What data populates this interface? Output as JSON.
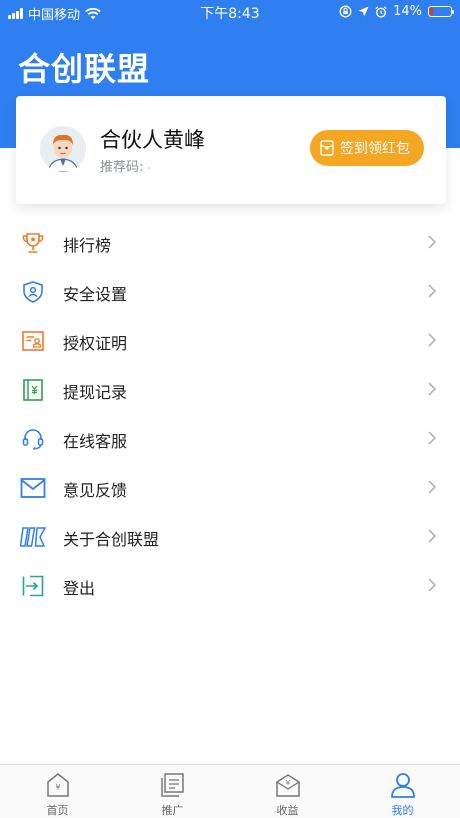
{
  "status_bar": {
    "carrier": "中国移动",
    "time": "下午8:43",
    "battery_pct": "14%",
    "battery_level": 0.14,
    "battery_color": "#e8342e"
  },
  "header": {
    "title": "合创联盟",
    "bg_color": "#2f7ff0"
  },
  "profile": {
    "name": "合伙人黄峰",
    "referral_label": "推荐码:",
    "referral_value": ".",
    "signin_button": "签到领红包",
    "signin_color": "#f5a623"
  },
  "menu": {
    "items": [
      {
        "label": "排行榜",
        "icon": "trophy-icon",
        "color": "#f07a2c"
      },
      {
        "label": "安全设置",
        "icon": "shield-user-icon",
        "color": "#2f7ff0"
      },
      {
        "label": "授权证明",
        "icon": "certificate-icon",
        "color": "#f07a2c"
      },
      {
        "label": "提现记录",
        "icon": "withdraw-record-icon",
        "color": "#2aa44f"
      },
      {
        "label": "在线客服",
        "icon": "headset-icon",
        "color": "#2f7ff0"
      },
      {
        "label": "意见反馈",
        "icon": "mail-icon",
        "color": "#2f7ff0"
      },
      {
        "label": "关于合创联盟",
        "icon": "logo-icon",
        "color": "#2f7ff0"
      },
      {
        "label": "登出",
        "icon": "logout-icon",
        "color": "#23a79b"
      }
    ]
  },
  "tabbar": {
    "tabs": [
      {
        "label": "首页",
        "icon": "home-icon"
      },
      {
        "label": "推广",
        "icon": "promote-icon"
      },
      {
        "label": "收益",
        "icon": "income-icon"
      },
      {
        "label": "我的",
        "icon": "profile-icon"
      }
    ],
    "active_color": "#2f7ff0"
  }
}
